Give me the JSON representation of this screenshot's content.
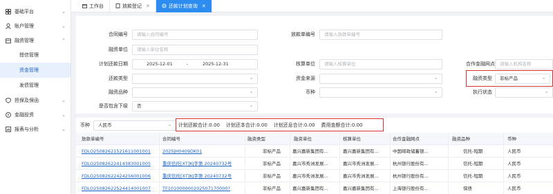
{
  "sidebar": {
    "items": [
      {
        "label": "基础平台",
        "icon": "grid-icon",
        "arrow": "⌄"
      },
      {
        "label": "账户管理",
        "icon": "user-icon",
        "arrow": "⌄"
      },
      {
        "label": "融资管理",
        "icon": "finance-icon",
        "arrow": "⌃"
      }
    ],
    "sub_items": [
      "授信管理",
      "资金管理",
      "发债管理"
    ],
    "active_sub": "资金管理",
    "bottom_items": [
      {
        "label": "担保及保函",
        "icon": "shield-icon",
        "arrow": "⌄"
      },
      {
        "label": "金融投资",
        "icon": "invest-icon",
        "arrow": "⌄"
      },
      {
        "label": "报表与分析",
        "icon": "report-icon",
        "arrow": "⌄"
      }
    ]
  },
  "tabs": [
    {
      "label": "工作台",
      "closable": false
    },
    {
      "label": "放款登记",
      "closable": true
    },
    {
      "label": "还款计划查询",
      "closable": true,
      "active": true
    }
  ],
  "search": {
    "contract_no": {
      "label": "合同编号",
      "placeholder": "请输入合同编号"
    },
    "loan_no": {
      "label": "放款单编号",
      "placeholder": "请输入放款单编号"
    },
    "finance_unit": {
      "label": "融资单位",
      "placeholder": "请输入单位名称"
    },
    "plan_date": {
      "label": "计划还款日期",
      "start": "2025-12-01",
      "sep": "-",
      "end": "2025-12-31"
    },
    "accounting_unit": {
      "label": "核算单位",
      "placeholder": "请输入核算单位"
    },
    "coop_branch": {
      "label": "合作金融网点",
      "placeholder": "请输入机构名称"
    },
    "repay_type": {
      "label": "还款类型",
      "value": ""
    },
    "fund_source": {
      "label": "资金来源",
      "value": ""
    },
    "finance_type": {
      "label": "融资类型",
      "value": "非标产品"
    },
    "finance_variety": {
      "label": "融资品种",
      "value": ""
    },
    "currency": {
      "label": "币种",
      "value": ""
    },
    "exec_status": {
      "label": "执行状态",
      "value": ""
    },
    "include_sub": {
      "label": "是否包含下级",
      "value": "否"
    }
  },
  "summary": {
    "currency_label": "币种",
    "currency_value": "人民币",
    "text": "计划还款合计:0.00    计划还本合计:0.00    计划还息合计:0.00    费用金额合计:0.00"
  },
  "table": {
    "headers": [
      "放款单编号",
      "合同编号",
      "融资类型",
      "融资单位",
      "核算单位",
      "合作金融网点",
      "融资品种",
      "币种"
    ],
    "rows": [
      [
        "FDLO25082621521611001001",
        "2025JH0409DK01",
        "非标产品",
        "嘉兴嘉新集团有...",
        "嘉兴嘉新集团有...",
        "中国邮政储蓄银...",
        "信托-短期",
        "人民币"
      ],
      [
        "FDLO25082622414383001005",
        "重庆信托[XT]KJ字第 20240732号",
        "非标产品",
        "嘉兴市秀洲发展...",
        "嘉兴市秀洲发展...",
        "杭州银行股份有...",
        "信托-短期",
        "人民币"
      ],
      [
        "FDLO25082622424256001006",
        "重庆信托[XT]KJ字第 20240732号",
        "非标产品",
        "嘉兴市秀洲发展...",
        "嘉兴市秀洲发展...",
        "杭州银行股份有...",
        "信托-短期",
        "人民币"
      ],
      [
        "FDLO25082622524414001007",
        "TF101000000202507170000?",
        "非标产品",
        "嘉兴嘉新集团有...",
        "嘉兴嘉新集团有...",
        "上海银行股份有...",
        "保债",
        "人民币"
      ]
    ]
  },
  "colors": {
    "accent": "#2d8cf0",
    "link": "#1e64c8",
    "highlight": "#d93030"
  }
}
